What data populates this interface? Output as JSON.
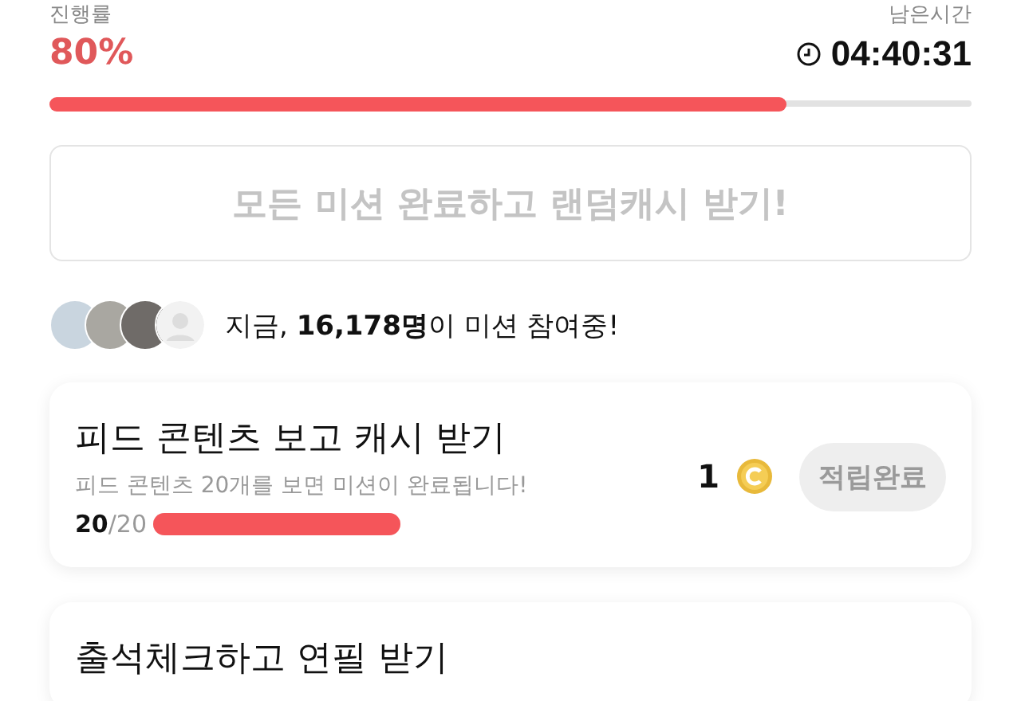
{
  "progress": {
    "label": "진행률",
    "value": "80%",
    "level": 0.8
  },
  "remaining": {
    "label": "남은시간",
    "value": "04:40:31"
  },
  "claim_all_button": {
    "label": "모든 미션 완료하고 랜덤캐시 받기!",
    "disabled": true
  },
  "participants": {
    "text": "지금, **16,178명**이 미션 참여중!"
  },
  "missions": [
    {
      "title": "피드 콘텐츠 보고 캐시 받기",
      "description": "피드 콘텐츠 20개를 보면 미션이 완료됩니다!",
      "count_done": "20",
      "count_total": "/20",
      "level": 1,
      "reward": "1",
      "button": "적립완료",
      "completed": true
    },
    {
      "title": "출석체크하고 연필 받기"
    }
  ]
}
